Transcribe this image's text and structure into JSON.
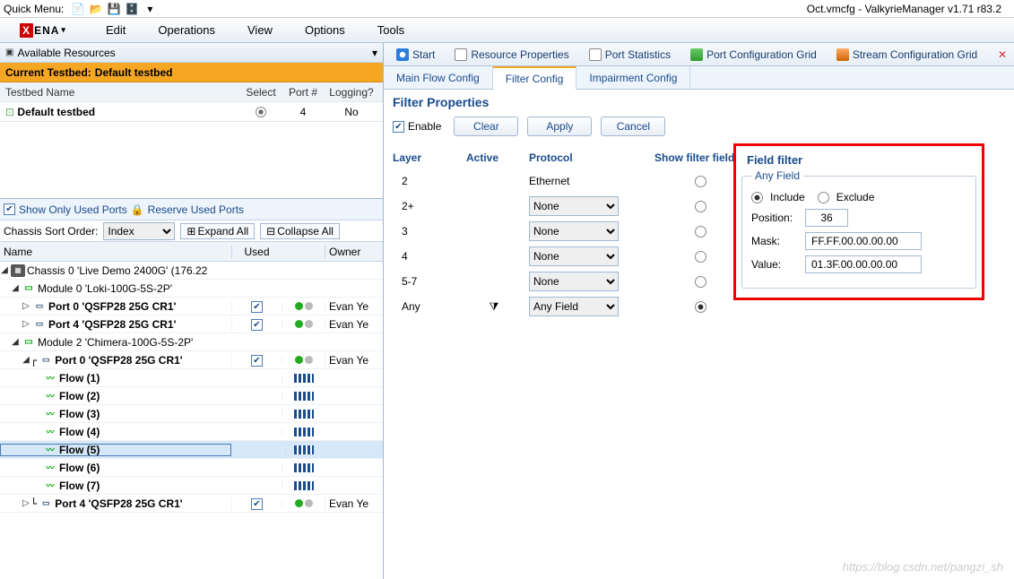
{
  "app": {
    "quick_menu": "Quick Menu:",
    "title_right": "Oct.vmcfg - ValkyrieManager v1.71 r83.2"
  },
  "menubar": {
    "logo_pre": "X",
    "logo_rest": "ENA",
    "items": [
      "Edit",
      "Operations",
      "View",
      "Options",
      "Tools"
    ]
  },
  "left": {
    "resources_title": "Available Resources",
    "current_testbed_label": "Current Testbed:",
    "current_testbed_value": "Default testbed",
    "testbed_cols": {
      "name": "Testbed Name",
      "select": "Select",
      "port": "Port #",
      "logging": "Logging?"
    },
    "testbed_rows": [
      {
        "name": "Default testbed",
        "select": true,
        "port": "4",
        "logging": "No"
      }
    ],
    "show_only": "Show Only Used Ports",
    "reserve": "Reserve Used Ports",
    "sort_label": "Chassis Sort Order:",
    "sort_value": "Index",
    "expand": "Expand All",
    "collapse": "Collapse All",
    "tree_cols": {
      "name": "Name",
      "used": "Used",
      "blank": "",
      "owner": "Owner"
    },
    "tree": [
      {
        "lvl": 0,
        "tog": "◢",
        "ic": "ch",
        "text": "Chassis 0 'Live Demo 2400G' (176.22",
        "bold": false
      },
      {
        "lvl": 1,
        "tog": "◢",
        "ic": "mod",
        "text": "Module 0 'Loki-100G-5S-2P'",
        "bold": false
      },
      {
        "lvl": 2,
        "tog": "▷",
        "ic": "port",
        "text": "Port 0 'QSFP28 25G CR1'",
        "bold": true,
        "used": true,
        "st": "gg",
        "owner": "Evan Ye"
      },
      {
        "lvl": 2,
        "tog": "▷",
        "ic": "port",
        "text": "Port 4 'QSFP28 25G CR1'",
        "bold": true,
        "used": true,
        "st": "gg",
        "owner": "Evan Ye"
      },
      {
        "lvl": 1,
        "tog": "◢",
        "ic": "mod",
        "text": "Module 2 'Chimera-100G-5S-2P'",
        "bold": false
      },
      {
        "lvl": 2,
        "tog": "◢",
        "ic": "port",
        "text": "Port 0 'QSFP28 25G CR1'",
        "bold": true,
        "used": true,
        "st": "gg",
        "owner": "Evan Ye",
        "pre": "┌"
      },
      {
        "lvl": 3,
        "ic": "flow",
        "text": "Flow (1)",
        "bold": true,
        "bar": true
      },
      {
        "lvl": 3,
        "ic": "flow",
        "text": "Flow (2)",
        "bold": true,
        "bar": true
      },
      {
        "lvl": 3,
        "ic": "flow",
        "text": "Flow (3)",
        "bold": true,
        "bar": true
      },
      {
        "lvl": 3,
        "ic": "flow",
        "text": "Flow (4)",
        "bold": true,
        "bar": true
      },
      {
        "lvl": 3,
        "ic": "flow",
        "text": "Flow (5)",
        "bold": true,
        "bar": true,
        "sel": true
      },
      {
        "lvl": 3,
        "ic": "flow",
        "text": "Flow (6)",
        "bold": true,
        "bar": true
      },
      {
        "lvl": 3,
        "ic": "flow",
        "text": "Flow (7)",
        "bold": true,
        "bar": true
      },
      {
        "lvl": 2,
        "tog": "▷",
        "ic": "port",
        "text": "Port 4 'QSFP28 25G CR1'",
        "bold": true,
        "used": true,
        "st": "gg",
        "owner": "Evan Ye",
        "pre": "└"
      }
    ]
  },
  "right": {
    "toolbar": [
      {
        "ic": "start",
        "label": "Start"
      },
      {
        "ic": "res",
        "label": "Resource Properties"
      },
      {
        "ic": "stat",
        "label": "Port Statistics"
      },
      {
        "ic": "cfg",
        "label": "Port Configuration Grid"
      },
      {
        "ic": "str",
        "label": "Stream Configuration Grid"
      }
    ],
    "tabs": [
      "Main Flow Config",
      "Filter Config",
      "Impairment Config"
    ],
    "active_tab": 1,
    "section_title": "Filter Properties",
    "enable_label": "Enable",
    "buttons": [
      "Clear",
      "Apply",
      "Cancel"
    ],
    "grid_cols": {
      "layer": "Layer",
      "active": "Active",
      "protocol": "Protocol",
      "show": "Show filter field"
    },
    "grid_rows": [
      {
        "layer": "2",
        "proto_text": "Ethernet",
        "is_select": false,
        "show_sel": false
      },
      {
        "layer": "2+",
        "proto_text": "None",
        "is_select": true,
        "show_sel": false
      },
      {
        "layer": "3",
        "proto_text": "None",
        "is_select": true,
        "show_sel": false
      },
      {
        "layer": "4",
        "proto_text": "None",
        "is_select": true,
        "show_sel": false
      },
      {
        "layer": "5-7",
        "proto_text": "None",
        "is_select": true,
        "show_sel": false
      },
      {
        "layer": "Any",
        "active_icon": "funnel",
        "proto_text": "Any Field",
        "is_select": true,
        "show_sel": true
      }
    ],
    "field_filter": {
      "title": "Field filter",
      "legend": "Any Field",
      "include": "Include",
      "exclude": "Exclude",
      "position_label": "Position:",
      "position": "36",
      "mask_label": "Mask:",
      "mask": "FF.FF.00.00.00.00",
      "value_label": "Value:",
      "value": "01.3F.00.00.00.00"
    }
  },
  "watermark": "https://blog.csdn.net/pangzi_sh"
}
